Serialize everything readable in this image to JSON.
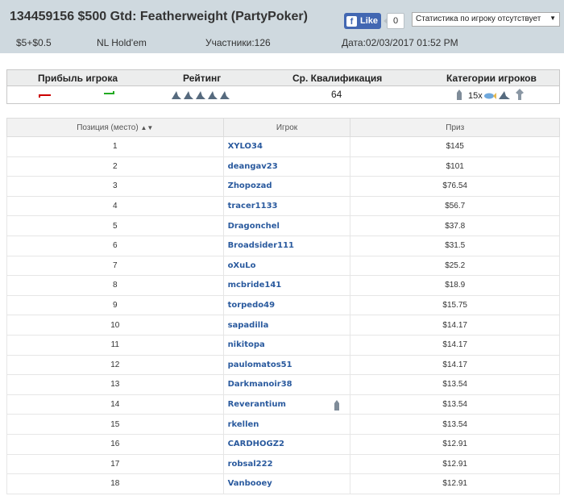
{
  "header": {
    "title": "134459156 $500 Gtd: Featherweight (PartyPoker)",
    "like_label": "Like",
    "like_count": "0",
    "stats_select_value": "Статистика по игроку отсутствует",
    "buyin": "$5+$0.5",
    "game": "NL Hold'em",
    "participants": "Участники:126",
    "date": "Дата:02/03/2017 01:52 PM"
  },
  "summary": {
    "headers": [
      "Прибыль игрока",
      "Рейтинг",
      "Ср. Квалификация",
      "Категории игроков"
    ],
    "avg_qualification": "64",
    "category_count": "15x",
    "rating_icons": 5,
    "colors": {
      "loss": "#cc0000",
      "gain": "#22aa22"
    }
  },
  "table": {
    "columns": [
      "Позиция (место)",
      "Игрок",
      "Приз"
    ],
    "rows": [
      {
        "pos": "1",
        "player": "XYLO34",
        "prize": "$145"
      },
      {
        "pos": "2",
        "player": "deangav23",
        "prize": "$101"
      },
      {
        "pos": "3",
        "player": "Zhopozad",
        "prize": "$76.54"
      },
      {
        "pos": "4",
        "player": "tracer1133",
        "prize": "$56.7"
      },
      {
        "pos": "5",
        "player": "Dragonchel",
        "prize": "$37.8"
      },
      {
        "pos": "6",
        "player": "Broadsider111",
        "prize": "$31.5"
      },
      {
        "pos": "7",
        "player": "oXuLo",
        "prize": "$25.2"
      },
      {
        "pos": "8",
        "player": "mcbride141",
        "prize": "$18.9"
      },
      {
        "pos": "9",
        "player": "torpedo49",
        "prize": "$15.75"
      },
      {
        "pos": "10",
        "player": "sapadilla",
        "prize": "$14.17"
      },
      {
        "pos": "11",
        "player": "nikitopa",
        "prize": "$14.17"
      },
      {
        "pos": "12",
        "player": "paulomatos51",
        "prize": "$14.17"
      },
      {
        "pos": "13",
        "player": "Darkmanoir38",
        "prize": "$13.54"
      },
      {
        "pos": "14",
        "player": "Reverantium",
        "prize": "$13.54",
        "icon": "player-category-icon"
      },
      {
        "pos": "15",
        "player": "rkellen",
        "prize": "$13.54"
      },
      {
        "pos": "16",
        "player": "CARDHOGZ2",
        "prize": "$12.91"
      },
      {
        "pos": "17",
        "player": "robsal222",
        "prize": "$12.91"
      },
      {
        "pos": "18",
        "player": "Vanbooey",
        "prize": "$12.91"
      }
    ]
  }
}
